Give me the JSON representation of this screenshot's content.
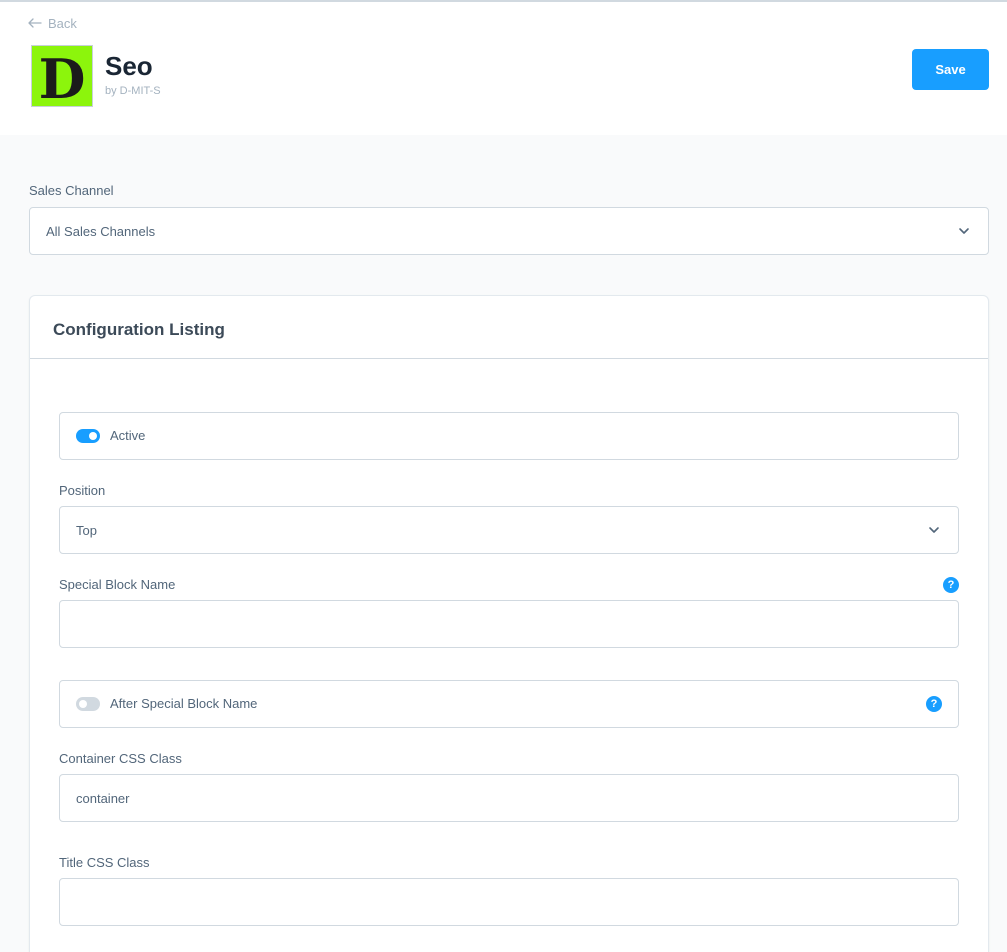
{
  "header": {
    "back_label": "Back",
    "app_title": "Seo",
    "app_subtitle": "by D-MIT-S",
    "logo_letter": "D",
    "save_label": "Save"
  },
  "sales_channel": {
    "label": "Sales Channel",
    "selected": "All Sales Channels"
  },
  "card": {
    "title": "Configuration Listing",
    "active": {
      "label": "Active",
      "checked": true
    },
    "position": {
      "label": "Position",
      "selected": "Top"
    },
    "special_block_name": {
      "label": "Special Block Name",
      "value": "",
      "help": "?"
    },
    "after_special_block_name": {
      "label": "After Special Block Name",
      "checked": false,
      "help": "?"
    },
    "container_css_class": {
      "label": "Container CSS Class",
      "value": "container"
    },
    "title_css_class": {
      "label": "Title CSS Class",
      "value": ""
    }
  },
  "colors": {
    "primary": "#189eff",
    "logo_background": "#8cf50c",
    "border": "#d1d9e0"
  },
  "icons": [
    "arrow-left-icon",
    "chevron-down-icon",
    "help-icon"
  ]
}
